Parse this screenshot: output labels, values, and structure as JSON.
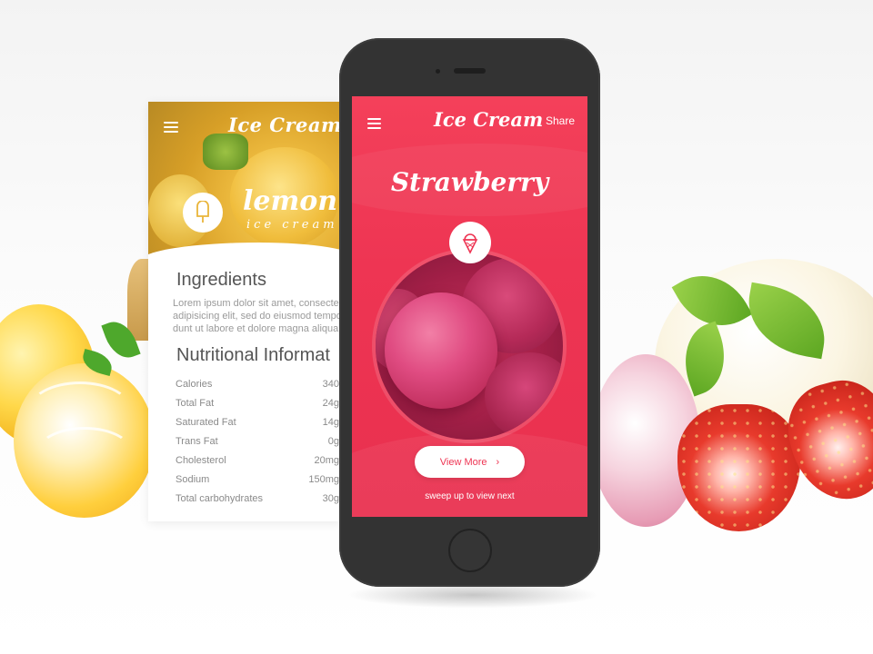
{
  "colors": {
    "primary": "#ee3553",
    "lemon": "#e9b53a",
    "phone_body": "#333333"
  },
  "lemon_card": {
    "app_title": "Ice Cream",
    "flavor": "lemon",
    "flavor_sub": "ice cream",
    "ingredients_heading": "Ingredients",
    "ingredients_text": [
      "Lorem ipsum dolor sit amet, consectetur",
      "adipisicing elit, sed do eiusmod tempor in",
      "dunt ut labore et dolore magna aliqua. Ut"
    ],
    "nutrition_heading": "Nutritional Informat",
    "nutrition": [
      {
        "label": "Calories",
        "value": "340"
      },
      {
        "label": "Total Fat",
        "value": "24g"
      },
      {
        "label": "Saturated Fat",
        "value": "14g"
      },
      {
        "label": "Trans Fat",
        "value": "0g"
      },
      {
        "label": "Cholesterol",
        "value": "20mg"
      },
      {
        "label": "Sodium",
        "value": "150mg"
      },
      {
        "label": "Total carbohydrates",
        "value": "30g"
      }
    ]
  },
  "phone_screen": {
    "app_title": "Ice Cream",
    "share_label": "Share",
    "flavor": "Strawberry",
    "view_more_label": "View More",
    "hint": "sweep up to view next"
  },
  "icons": [
    "menu-icon",
    "popsicle-icon",
    "ice-cream-cone-icon",
    "chevron-right-icon"
  ]
}
